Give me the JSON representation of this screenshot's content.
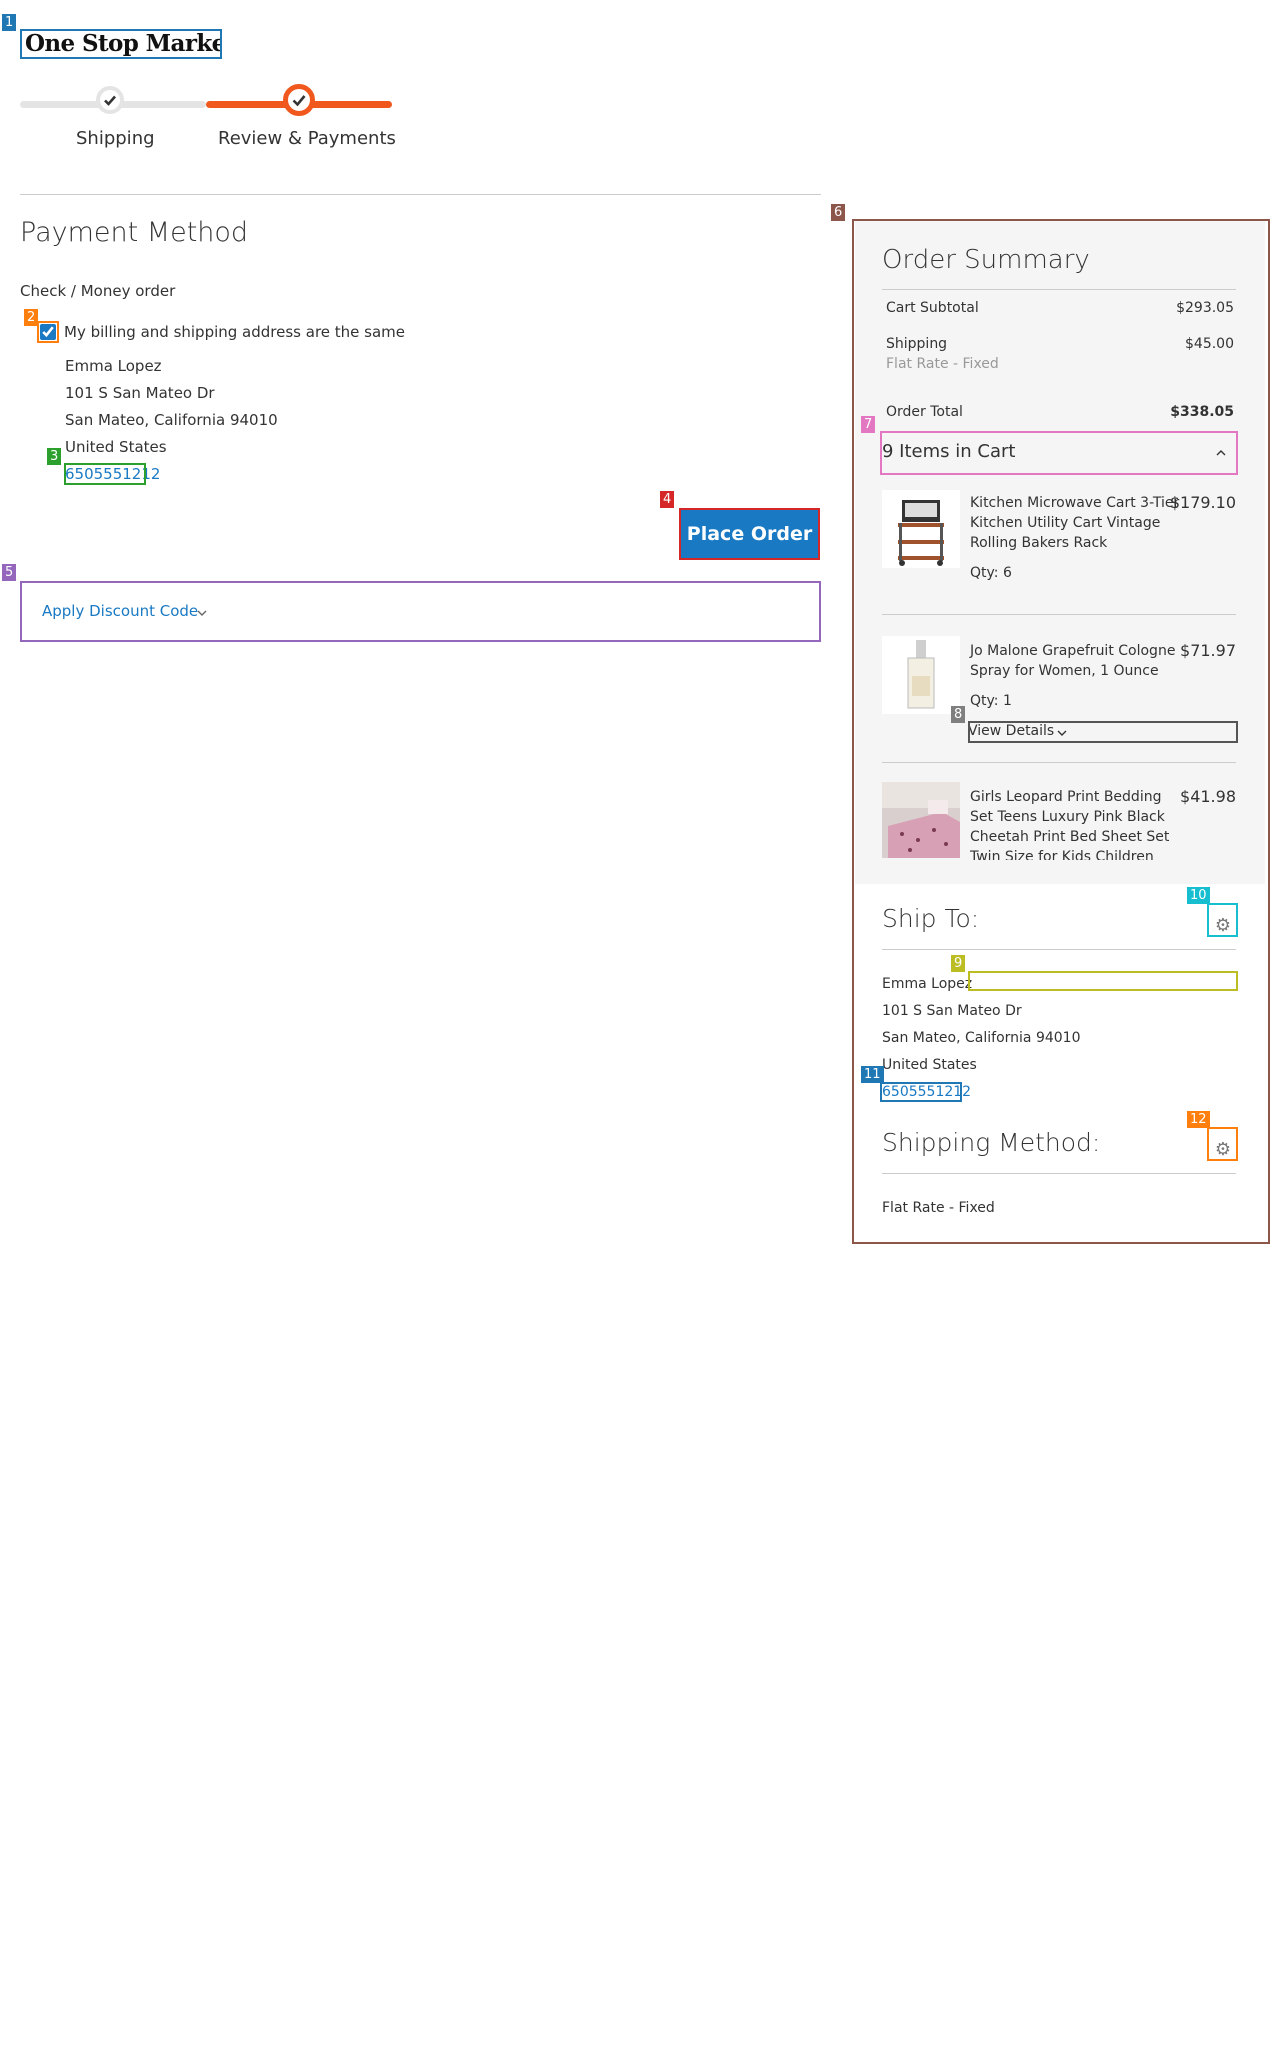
{
  "logo": {
    "text": "One Stop Market"
  },
  "progress": {
    "steps": [
      {
        "label": "Shipping",
        "status": "complete"
      },
      {
        "label": "Review & Payments",
        "status": "active"
      }
    ],
    "active_color": "#f1581d",
    "inactive_color": "#e4e4e4"
  },
  "payment": {
    "title": "Payment Method",
    "method": "Check / Money order",
    "same_address_label": "My billing and shipping address are the same",
    "same_address_checked": true,
    "address": {
      "name": "Emma Lopez",
      "street": "101 S San Mateo Dr",
      "city_line": "San Mateo, California 94010",
      "country": "United States",
      "phone": "6505551212"
    },
    "place_order_label": "Place Order"
  },
  "discount": {
    "label": "Apply Discount Code"
  },
  "summary": {
    "title": "Order Summary",
    "subtotal_label": "Cart Subtotal",
    "subtotal_value": "$293.05",
    "shipping_label": "Shipping",
    "shipping_method": "Flat Rate - Fixed",
    "shipping_value": "$45.00",
    "total_label": "Order Total",
    "total_value": "$338.05",
    "items_toggle": "9 Items in Cart",
    "items": [
      {
        "name": "Kitchen Microwave Cart 3-Tier Kitchen Utility Cart Vintage Rolling Bakers Rack",
        "price": "$179.10",
        "qty": "Qty: 6"
      },
      {
        "name": "Jo Malone Grapefruit Cologne Spray for Women, 1 Ounce",
        "price": "$71.97",
        "qty": "Qty: 1",
        "details": "View Details"
      },
      {
        "name": "Girls Leopard Print Bedding Set Teens Luxury Pink Black Cheetah Print Bed Sheet Set Twin Size for Kids Children",
        "price": "$41.98"
      }
    ]
  },
  "ship_to": {
    "title": "Ship To:",
    "name": "Emma Lopez",
    "street": "101 S San Mateo Dr",
    "city_line": "San Mateo, California 94010",
    "country": "United States",
    "phone": "6505551212"
  },
  "shipping_method": {
    "title": "Shipping Method:",
    "value": "Flat Rate - Fixed"
  },
  "annotation_tags": [
    "1",
    "2",
    "3",
    "4",
    "5",
    "6",
    "7",
    "8",
    "9",
    "10",
    "11",
    "12"
  ]
}
